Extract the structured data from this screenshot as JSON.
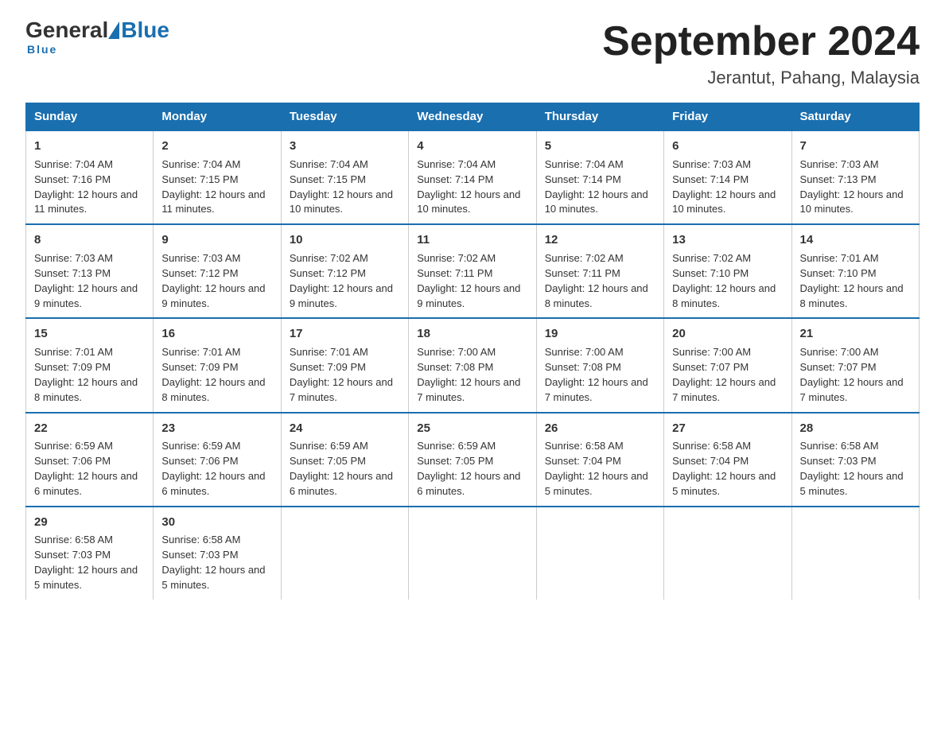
{
  "logo": {
    "general": "General",
    "blue": "Blue",
    "underline": "Blue"
  },
  "title": "September 2024",
  "subtitle": "Jerantut, Pahang, Malaysia",
  "days": [
    "Sunday",
    "Monday",
    "Tuesday",
    "Wednesday",
    "Thursday",
    "Friday",
    "Saturday"
  ],
  "weeks": [
    [
      {
        "num": "1",
        "sunrise": "7:04 AM",
        "sunset": "7:16 PM",
        "daylight": "12 hours and 11 minutes."
      },
      {
        "num": "2",
        "sunrise": "7:04 AM",
        "sunset": "7:15 PM",
        "daylight": "12 hours and 11 minutes."
      },
      {
        "num": "3",
        "sunrise": "7:04 AM",
        "sunset": "7:15 PM",
        "daylight": "12 hours and 10 minutes."
      },
      {
        "num": "4",
        "sunrise": "7:04 AM",
        "sunset": "7:14 PM",
        "daylight": "12 hours and 10 minutes."
      },
      {
        "num": "5",
        "sunrise": "7:04 AM",
        "sunset": "7:14 PM",
        "daylight": "12 hours and 10 minutes."
      },
      {
        "num": "6",
        "sunrise": "7:03 AM",
        "sunset": "7:14 PM",
        "daylight": "12 hours and 10 minutes."
      },
      {
        "num": "7",
        "sunrise": "7:03 AM",
        "sunset": "7:13 PM",
        "daylight": "12 hours and 10 minutes."
      }
    ],
    [
      {
        "num": "8",
        "sunrise": "7:03 AM",
        "sunset": "7:13 PM",
        "daylight": "12 hours and 9 minutes."
      },
      {
        "num": "9",
        "sunrise": "7:03 AM",
        "sunset": "7:12 PM",
        "daylight": "12 hours and 9 minutes."
      },
      {
        "num": "10",
        "sunrise": "7:02 AM",
        "sunset": "7:12 PM",
        "daylight": "12 hours and 9 minutes."
      },
      {
        "num": "11",
        "sunrise": "7:02 AM",
        "sunset": "7:11 PM",
        "daylight": "12 hours and 9 minutes."
      },
      {
        "num": "12",
        "sunrise": "7:02 AM",
        "sunset": "7:11 PM",
        "daylight": "12 hours and 8 minutes."
      },
      {
        "num": "13",
        "sunrise": "7:02 AM",
        "sunset": "7:10 PM",
        "daylight": "12 hours and 8 minutes."
      },
      {
        "num": "14",
        "sunrise": "7:01 AM",
        "sunset": "7:10 PM",
        "daylight": "12 hours and 8 minutes."
      }
    ],
    [
      {
        "num": "15",
        "sunrise": "7:01 AM",
        "sunset": "7:09 PM",
        "daylight": "12 hours and 8 minutes."
      },
      {
        "num": "16",
        "sunrise": "7:01 AM",
        "sunset": "7:09 PM",
        "daylight": "12 hours and 8 minutes."
      },
      {
        "num": "17",
        "sunrise": "7:01 AM",
        "sunset": "7:09 PM",
        "daylight": "12 hours and 7 minutes."
      },
      {
        "num": "18",
        "sunrise": "7:00 AM",
        "sunset": "7:08 PM",
        "daylight": "12 hours and 7 minutes."
      },
      {
        "num": "19",
        "sunrise": "7:00 AM",
        "sunset": "7:08 PM",
        "daylight": "12 hours and 7 minutes."
      },
      {
        "num": "20",
        "sunrise": "7:00 AM",
        "sunset": "7:07 PM",
        "daylight": "12 hours and 7 minutes."
      },
      {
        "num": "21",
        "sunrise": "7:00 AM",
        "sunset": "7:07 PM",
        "daylight": "12 hours and 7 minutes."
      }
    ],
    [
      {
        "num": "22",
        "sunrise": "6:59 AM",
        "sunset": "7:06 PM",
        "daylight": "12 hours and 6 minutes."
      },
      {
        "num": "23",
        "sunrise": "6:59 AM",
        "sunset": "7:06 PM",
        "daylight": "12 hours and 6 minutes."
      },
      {
        "num": "24",
        "sunrise": "6:59 AM",
        "sunset": "7:05 PM",
        "daylight": "12 hours and 6 minutes."
      },
      {
        "num": "25",
        "sunrise": "6:59 AM",
        "sunset": "7:05 PM",
        "daylight": "12 hours and 6 minutes."
      },
      {
        "num": "26",
        "sunrise": "6:58 AM",
        "sunset": "7:04 PM",
        "daylight": "12 hours and 5 minutes."
      },
      {
        "num": "27",
        "sunrise": "6:58 AM",
        "sunset": "7:04 PM",
        "daylight": "12 hours and 5 minutes."
      },
      {
        "num": "28",
        "sunrise": "6:58 AM",
        "sunset": "7:03 PM",
        "daylight": "12 hours and 5 minutes."
      }
    ],
    [
      {
        "num": "29",
        "sunrise": "6:58 AM",
        "sunset": "7:03 PM",
        "daylight": "12 hours and 5 minutes."
      },
      {
        "num": "30",
        "sunrise": "6:58 AM",
        "sunset": "7:03 PM",
        "daylight": "12 hours and 5 minutes."
      },
      null,
      null,
      null,
      null,
      null
    ]
  ],
  "labels": {
    "sunrise": "Sunrise: ",
    "sunset": "Sunset: ",
    "daylight": "Daylight: "
  }
}
